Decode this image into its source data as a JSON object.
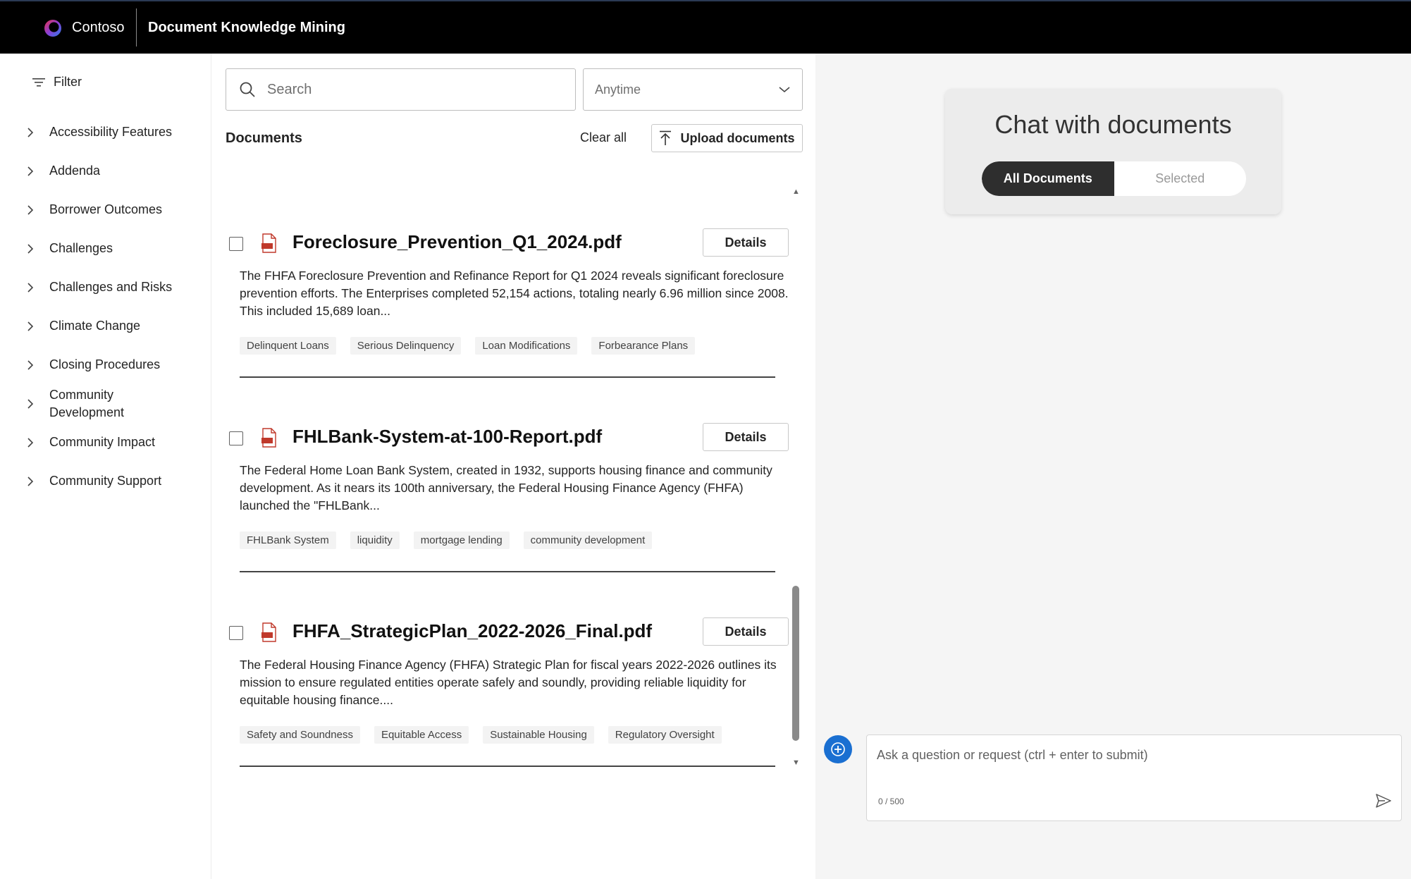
{
  "header": {
    "brand": "Contoso",
    "app_title": "Document Knowledge Mining"
  },
  "filter": {
    "label": "Filter",
    "items": [
      {
        "label": "Accessibility Features"
      },
      {
        "label": "Addenda"
      },
      {
        "label": "Borrower Outcomes"
      },
      {
        "label": "Challenges"
      },
      {
        "label": "Challenges and Risks"
      },
      {
        "label": "Climate Change"
      },
      {
        "label": "Closing Procedures"
      },
      {
        "label": "Community Development"
      },
      {
        "label": "Community Impact"
      },
      {
        "label": "Community Support"
      }
    ]
  },
  "search": {
    "placeholder": "Search",
    "value": "",
    "date_filter": "Anytime"
  },
  "documents": {
    "title": "Documents",
    "clear_all": "Clear all",
    "upload_label": "Upload documents",
    "details_label": "Details",
    "items": [
      {
        "name": "Foreclosure_Prevention_Q1_2024.pdf",
        "summary": "The FHFA Foreclosure Prevention and Refinance Report for Q1 2024 reveals significant foreclosure prevention efforts. The Enterprises completed 52,154 actions, totaling nearly 6.96 million since 2008. This included 15,689 loan...",
        "tags": [
          "Delinquent Loans",
          "Serious Delinquency",
          "Loan Modifications",
          "Forbearance Plans"
        ]
      },
      {
        "name": "FHLBank-System-at-100-Report.pdf",
        "summary": "The Federal Home Loan Bank System, created in 1932, supports housing finance and community development. As it nears its 100th anniversary, the Federal Housing Finance Agency (FHFA) launched the \"FHLBank...",
        "tags": [
          "FHLBank System",
          "liquidity",
          "mortgage lending",
          "community development"
        ]
      },
      {
        "name": "FHFA_StrategicPlan_2022-2026_Final.pdf",
        "summary": "The Federal Housing Finance Agency (FHFA) Strategic Plan for fiscal years 2022-2026 outlines its mission to ensure regulated entities operate safely and soundly, providing reliable liquidity for equitable housing finance....",
        "tags": [
          "Safety and Soundness",
          "Equitable Access",
          "Sustainable Housing",
          "Regulatory Oversight"
        ]
      }
    ]
  },
  "chat": {
    "title": "Chat with documents",
    "toggle_all": "All Documents",
    "toggle_selected": "Selected",
    "input_placeholder": "Ask a question or request (ctrl + enter to submit)",
    "char_count": "0 / 500"
  },
  "colors": {
    "header_bg": "#000000",
    "accent": "#1a6fd1",
    "toggle_active": "#2e2e2e",
    "pdf_icon": "#c0392b"
  },
  "icons": {
    "logo": "contoso-logo-icon",
    "filter": "filter-icon",
    "chevron": "chevron-right-icon",
    "search": "search-icon",
    "dropdown": "chevron-down-icon",
    "upload": "upload-icon",
    "pdf": "pdf-file-icon",
    "new_chat": "new-chat-icon",
    "send": "send-icon"
  }
}
